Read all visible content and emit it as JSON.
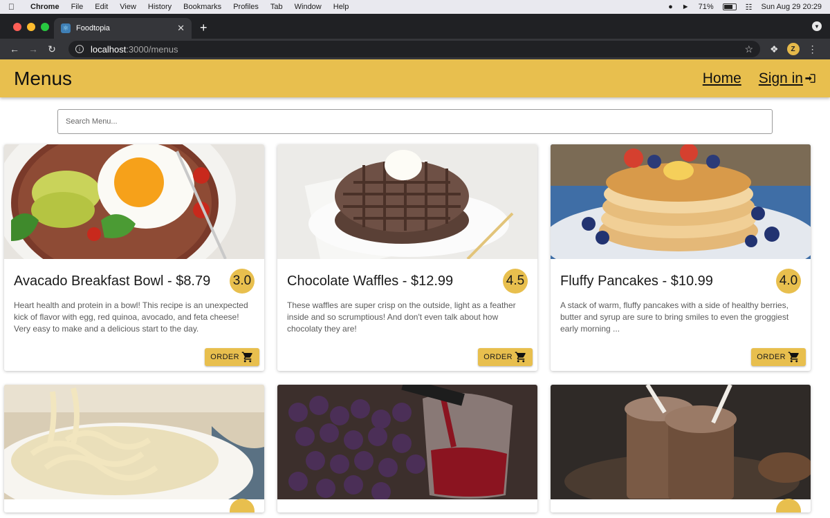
{
  "menubar": {
    "app": "Chrome",
    "items": [
      "File",
      "Edit",
      "View",
      "History",
      "Bookmarks",
      "Profiles",
      "Tab",
      "Window",
      "Help"
    ],
    "battery": "71%",
    "datetime": "Sun Aug 29  20:29"
  },
  "browser": {
    "tab_title": "Foodtopia",
    "url_host": "localhost",
    "url_path": ":3000/menus",
    "profile_initial": "Z"
  },
  "app": {
    "title": "Menus",
    "nav_home": "Home",
    "nav_signin": "Sign in",
    "accent": "#e8bf4e"
  },
  "search": {
    "placeholder": "Search Menu..."
  },
  "menus": [
    {
      "name": "Avacado Breakfast Bowl - $8.79",
      "rating": "3.0",
      "description": "Heart health and protein in a bowl! This recipe is an unexpected kick of flavor with egg, red quinoa, avocado, and feta cheese! Very easy to make and a delicious start to the day.",
      "order_label": "ORDER"
    },
    {
      "name": "Chocolate Waffles - $12.99",
      "rating": "4.5",
      "description": "These waffles are super crisp on the outside, light as a feather inside and so scrumptious! And don't even talk about how chocolaty they are!",
      "order_label": "ORDER"
    },
    {
      "name": "Fluffy Pancakes - $10.99",
      "rating": "4.0",
      "description": "A stack of warm, fluffy pancakes with a side of healthy berries, butter and syrup are sure to bring smiles to even the groggiest early morning ...",
      "order_label": "ORDER"
    }
  ]
}
